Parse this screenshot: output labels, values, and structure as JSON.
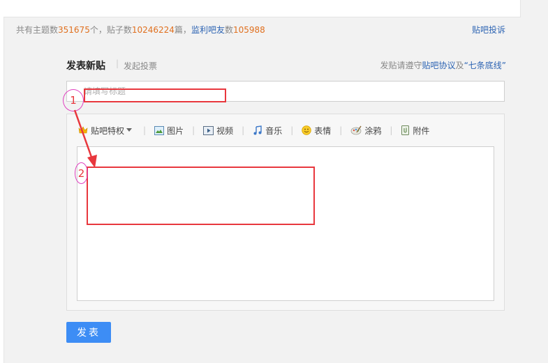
{
  "stats": {
    "topics_label": "共有主题数",
    "topics_count": "351675",
    "topics_unit": "个，贴子数",
    "posts_count": "10246224",
    "posts_unit": "篇，",
    "members_label": "监利吧友",
    "members_unit": "数",
    "members_count": "105988"
  },
  "header": {
    "complaint_link": "贴吧投诉"
  },
  "tabs": {
    "post": "发表新贴",
    "separator": "|",
    "vote": "发起投票"
  },
  "notice": {
    "prefix": "发贴请遵守",
    "link1": "贴吧协议",
    "mid": "及",
    "link2": "“七条底线”"
  },
  "title_input": {
    "placeholder": "请填写标题",
    "value": ""
  },
  "toolbar": {
    "items": [
      {
        "label": "贴吧特权",
        "icon": "crown-icon",
        "has_dropdown": true
      },
      {
        "label": "图片",
        "icon": "image-icon"
      },
      {
        "label": "视频",
        "icon": "video-icon"
      },
      {
        "label": "音乐",
        "icon": "music-note-icon"
      },
      {
        "label": "表情",
        "icon": "smiley-icon"
      },
      {
        "label": "涂鸦",
        "icon": "paint-palette-icon"
      },
      {
        "label": "附件",
        "icon": "attachment-icon"
      }
    ]
  },
  "submit_button": {
    "label": "发表"
  },
  "annotations": {
    "marker1": "1",
    "marker2": "2",
    "color": "#e8373d",
    "circle_color": "#e040c0"
  },
  "colors": {
    "accent": "#3d8df5",
    "link": "#2d64b3",
    "number": "#e0701f"
  }
}
